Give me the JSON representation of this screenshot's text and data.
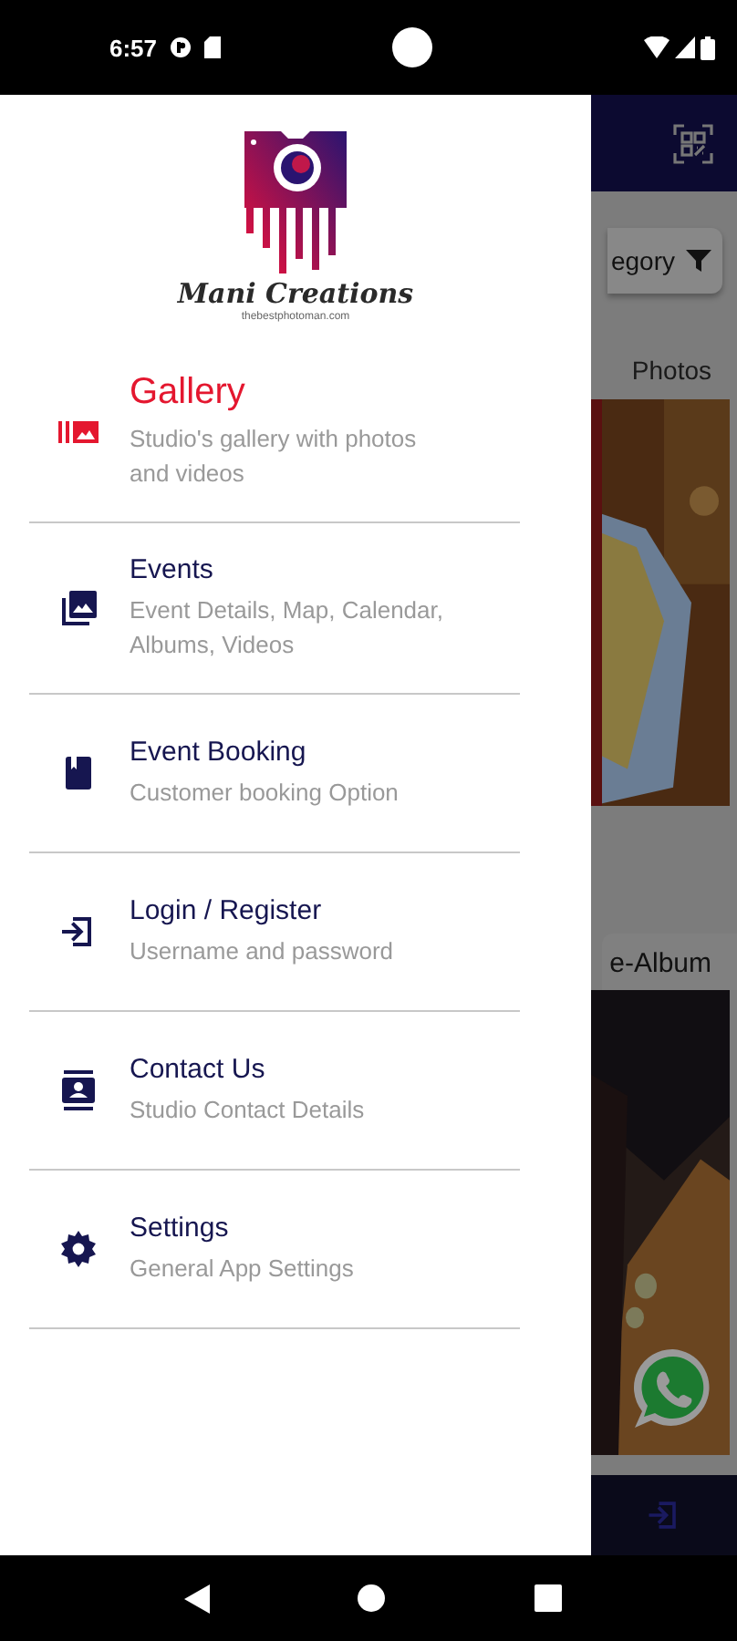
{
  "status_bar": {
    "time": "6:57"
  },
  "drawer": {
    "brand": {
      "name": "Mani Creations",
      "tagline": "thebestphotoman.com"
    },
    "items": [
      {
        "kind": "gallery",
        "title": "Gallery",
        "subtitle": "Studio's gallery with photos and videos",
        "selected": true
      },
      {
        "kind": "events",
        "title": "Events",
        "subtitle": "Event Details, Map, Calendar, Albums, Videos",
        "selected": false
      },
      {
        "kind": "booking",
        "title": "Event Booking",
        "subtitle": "Customer booking Option",
        "selected": false
      },
      {
        "kind": "login",
        "title": "Login / Register",
        "subtitle": "Username and password",
        "selected": false
      },
      {
        "kind": "contact",
        "title": "Contact Us",
        "subtitle": "Studio Contact Details",
        "selected": false
      },
      {
        "kind": "settings",
        "title": "Settings",
        "subtitle": "General App Settings",
        "selected": false
      }
    ]
  },
  "background": {
    "category_button": "egory",
    "sections": [
      "Photos",
      "e-Album"
    ]
  }
}
